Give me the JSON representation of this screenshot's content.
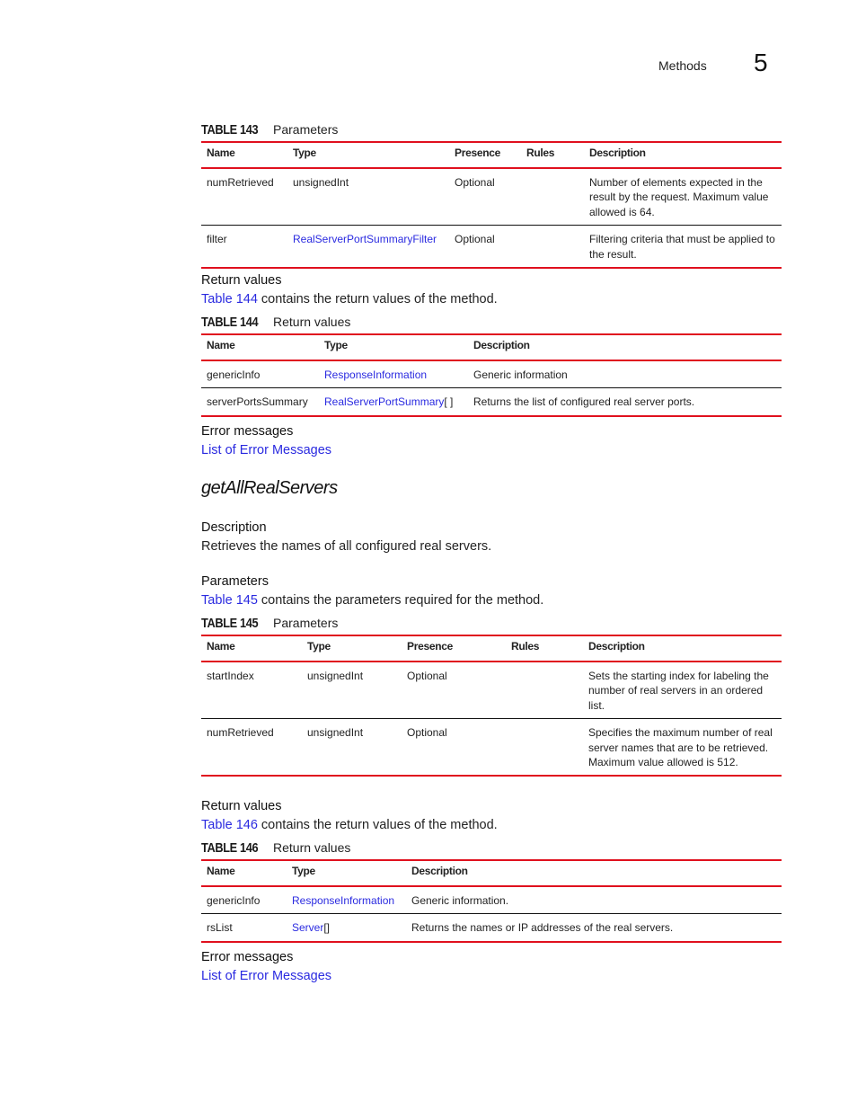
{
  "header": {
    "section": "Methods",
    "chapter": "5"
  },
  "table143": {
    "number": "TABLE 143",
    "title": "Parameters",
    "columns": [
      "Name",
      "Type",
      "Presence",
      "Rules",
      "Description"
    ],
    "rows": [
      {
        "name": "numRetrieved",
        "type": "unsignedInt",
        "type_link": false,
        "type_suffix": "",
        "presence": "Optional",
        "rules": "",
        "description": "Number of elements expected in the result by the request. Maximum value allowed is 64."
      },
      {
        "name": "filter",
        "type": "RealServerPortSummaryFilter",
        "type_link": true,
        "type_suffix": "",
        "presence": "Optional",
        "rules": "",
        "description": "Filtering criteria that must be applied to the result."
      }
    ]
  },
  "return_values_1": {
    "heading": "Return values",
    "link": "Table 144",
    "text": " contains the return values of the method."
  },
  "table144": {
    "number": "TABLE 144",
    "title": "Return values",
    "columns": [
      "Name",
      "Type",
      "Description"
    ],
    "rows": [
      {
        "name": "genericInfo",
        "type": "ResponseInformation",
        "type_suffix": "",
        "description": "Generic information"
      },
      {
        "name": "serverPortsSummary",
        "type": "RealServerPortSummary",
        "type_suffix": "[ ]",
        "description": "Returns the list of configured real server ports."
      }
    ]
  },
  "error_messages_1": {
    "heading": "Error messages",
    "link": "List of Error Messages"
  },
  "method": {
    "title": "getAllRealServers",
    "description_heading": "Description",
    "description": "Retrieves the names of all configured real servers.",
    "parameters_heading": "Parameters",
    "parameters_link": "Table 145",
    "parameters_text": " contains the parameters required for the method."
  },
  "table145": {
    "number": "TABLE 145",
    "title": "Parameters",
    "columns": [
      "Name",
      "Type",
      "Presence",
      "Rules",
      "Description"
    ],
    "rows": [
      {
        "name": "startIndex",
        "type": "unsignedInt",
        "presence": "Optional",
        "rules": "",
        "description": "Sets the starting index for labeling the number of real servers in an ordered list."
      },
      {
        "name": "numRetrieved",
        "type": "unsignedInt",
        "presence": "Optional",
        "rules": "",
        "description": "Specifies the maximum number of real server names that are to be retrieved. Maximum value allowed is 512."
      }
    ]
  },
  "return_values_2": {
    "heading": "Return values",
    "link": "Table 146",
    "text": " contains the return values of the method."
  },
  "table146": {
    "number": "TABLE 146",
    "title": "Return values",
    "columns": [
      "Name",
      "Type",
      "Description"
    ],
    "rows": [
      {
        "name": "genericInfo",
        "type": "ResponseInformation",
        "type_suffix": "",
        "description": "Generic information."
      },
      {
        "name": "rsList",
        "type": "Server",
        "type_suffix": "[]",
        "description": "Returns the names or IP addresses of the real servers."
      }
    ]
  },
  "error_messages_2": {
    "heading": "Error messages",
    "link": "List of Error Messages"
  }
}
